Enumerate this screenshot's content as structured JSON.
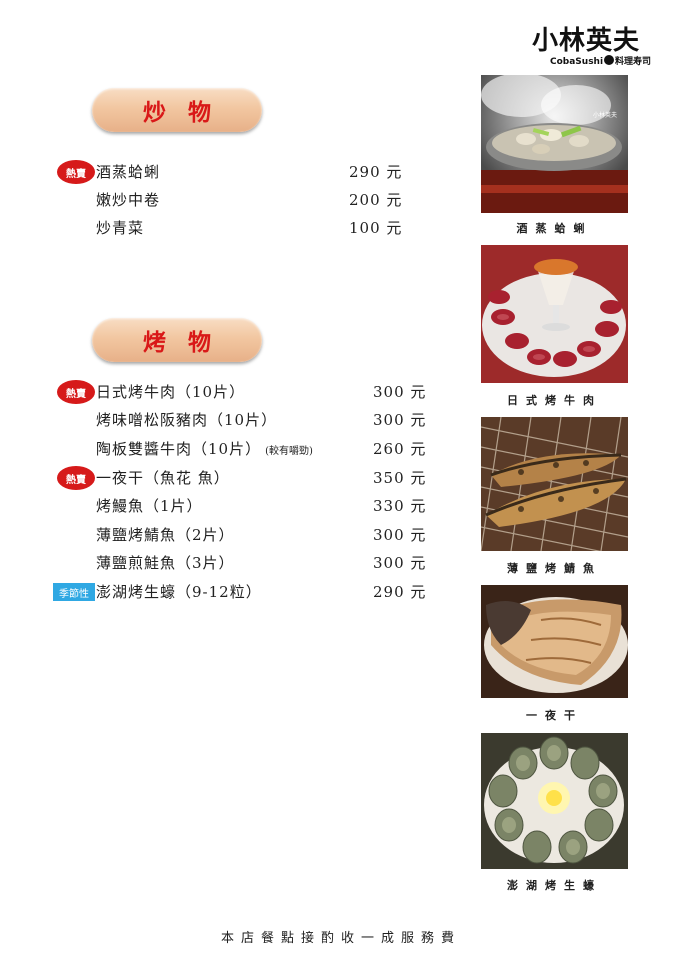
{
  "logo": {
    "brand": "小林英夫",
    "sub_left": "CobaSushi",
    "sub_right": "料理寿司"
  },
  "sections": [
    {
      "title": "炒物",
      "items": [
        {
          "badge": "熱賣",
          "name": "酒蒸蛤蜊",
          "note": "",
          "price": "290 元"
        },
        {
          "badge": "",
          "name": "嫩炒中卷",
          "note": "",
          "price": "200 元"
        },
        {
          "badge": "",
          "name": "炒青菜",
          "note": "",
          "price": "100 元"
        }
      ]
    },
    {
      "title": "烤物",
      "items": [
        {
          "badge": "熱賣",
          "name": "日式烤牛肉（10片）",
          "note": "",
          "price": "300 元"
        },
        {
          "badge": "",
          "name": "烤味噌松阪豬肉（10片）",
          "note": "",
          "price": "300 元"
        },
        {
          "badge": "",
          "name": "陶板雙醬牛肉（10片）",
          "note": "(較有嚼勁)",
          "price": "260 元"
        },
        {
          "badge": "熱賣",
          "name": "一夜干（魚花 魚）",
          "note": "",
          "price": "350 元"
        },
        {
          "badge": "",
          "name": "烤鰻魚（1片）",
          "note": "",
          "price": "330 元"
        },
        {
          "badge": "",
          "name": "薄鹽烤鯖魚（2片）",
          "note": "",
          "price": "300 元"
        },
        {
          "badge": "",
          "name": "薄鹽煎鮭魚（3片）",
          "note": "",
          "price": "300 元"
        },
        {
          "badge": "季節性",
          "name": "澎湖烤生蠔（9-12粒）",
          "note": "",
          "price": "290 元"
        }
      ]
    }
  ],
  "photos": [
    {
      "caption": "酒蒸蛤蜊",
      "watermark": "小林英夫",
      "icon": "clam-pot-photo"
    },
    {
      "caption": "日式烤牛肉",
      "icon": "beef-plate-photo"
    },
    {
      "caption": "薄鹽烤鯖魚",
      "icon": "grilled-mackerel-photo"
    },
    {
      "caption": "一夜干",
      "icon": "dried-fish-photo"
    },
    {
      "caption": "澎湖烤生蠔",
      "icon": "oyster-plate-photo"
    }
  ],
  "footer": "本店餐點接酌收一成服務費",
  "colors": {
    "title_red": "#d91818",
    "hot_badge": "#d61a1a",
    "season_badge": "#2fa8e3",
    "pill": "#f2c7a1"
  }
}
